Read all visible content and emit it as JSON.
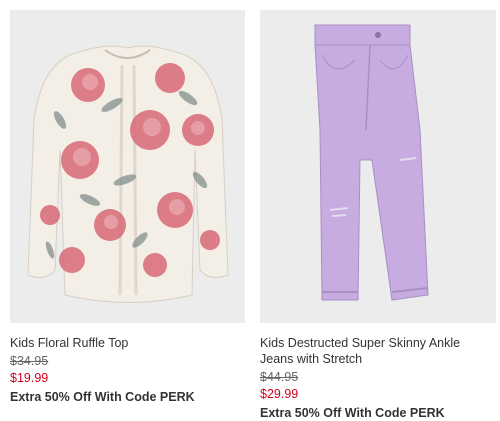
{
  "products": [
    {
      "name": "Kids Floral Ruffle Top",
      "original_price": "$34.95",
      "sale_price": "$19.99",
      "promo": "Extra 50% Off With Code PERK",
      "image_colors": {
        "background": "#ececec",
        "fabric": "#f3eee6",
        "flower": "#d9707c",
        "leaf": "#7c8a88"
      }
    },
    {
      "name": "Kids Destructed Super Skinny Ankle Jeans with Stretch",
      "original_price": "$44.95",
      "sale_price": "$29.99",
      "promo": "Extra 50% Off With Code PERK",
      "image_colors": {
        "background": "#ececec",
        "fabric": "#c6ace0"
      }
    }
  ],
  "colors": {
    "sale_price": "#d0021b",
    "text": "#333333",
    "struck_price": "#666666"
  }
}
